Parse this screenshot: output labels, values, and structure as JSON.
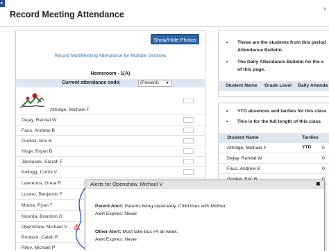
{
  "page": {
    "title": "Record Meeting Attendance",
    "close_glyph": "x"
  },
  "left": {
    "show_hide_label": "Show/Hide Photos",
    "subtitle": "Record MultiMeeting Attendance for Multiple Sections",
    "homeroom": "Homeroom - 1(A)",
    "code_label": "Current attendance code:",
    "code_value": "(Present)",
    "students": [
      "Attridge, Michael F",
      "Dejay, Randal W",
      "Faus, Andrew B",
      "Gunkel, Eric B",
      "Hoge, Bryan D",
      "Janousek, Sarrah F",
      "Kellogg, Cortni V",
      "Lawrence, Greta R",
      "Lucero, Benjamin F",
      "Moore, Ryan T",
      "Noorda, Brandon G",
      "Openshaw, Michael V",
      "Pontack, Caleb P",
      "Riley, Michael P"
    ]
  },
  "right_top": {
    "bullet1_l1": "These are the students from this period",
    "bullet1_l2": "Attendance Bulletin.",
    "bullet2_l1": "The Daily Attendance Bulletin for the e",
    "bullet2_l2": "of this page.",
    "col_student": "Student Name",
    "col_grade": "Grade Level",
    "col_daily": "Daily Attenda"
  },
  "right_bottom": {
    "bullet1": "YTD absences and tardies for this class",
    "bullet2": "This is for the full length of this class",
    "col_student": "Student Name",
    "col_tardies": "Tardies YTD",
    "rows": [
      {
        "name": "Attridge, Michael F",
        "value": "0"
      },
      {
        "name": "Dejay, Randal W",
        "value": "0"
      },
      {
        "name": "Faus, Andrew B",
        "value": "0"
      },
      {
        "name": "Gunkel, Eric B",
        "value": "0"
      }
    ]
  },
  "popup": {
    "title": "Alerts for Openshaw, Michael V",
    "close": "✖",
    "parent_label": "Parent Alert:",
    "parent_text": "Parents living separately. Child lives with Mother.",
    "parent_expires": "Alert Expires: Never",
    "other_label": "Other Alert:",
    "other_text": "Must take bus #4 all week.",
    "other_expires": "Alert Expires: Never"
  },
  "colors": {
    "accent": "#2f63a3",
    "header_bg": "#dde7f2",
    "link": "#2f75b9",
    "warning": "#d9342b"
  }
}
